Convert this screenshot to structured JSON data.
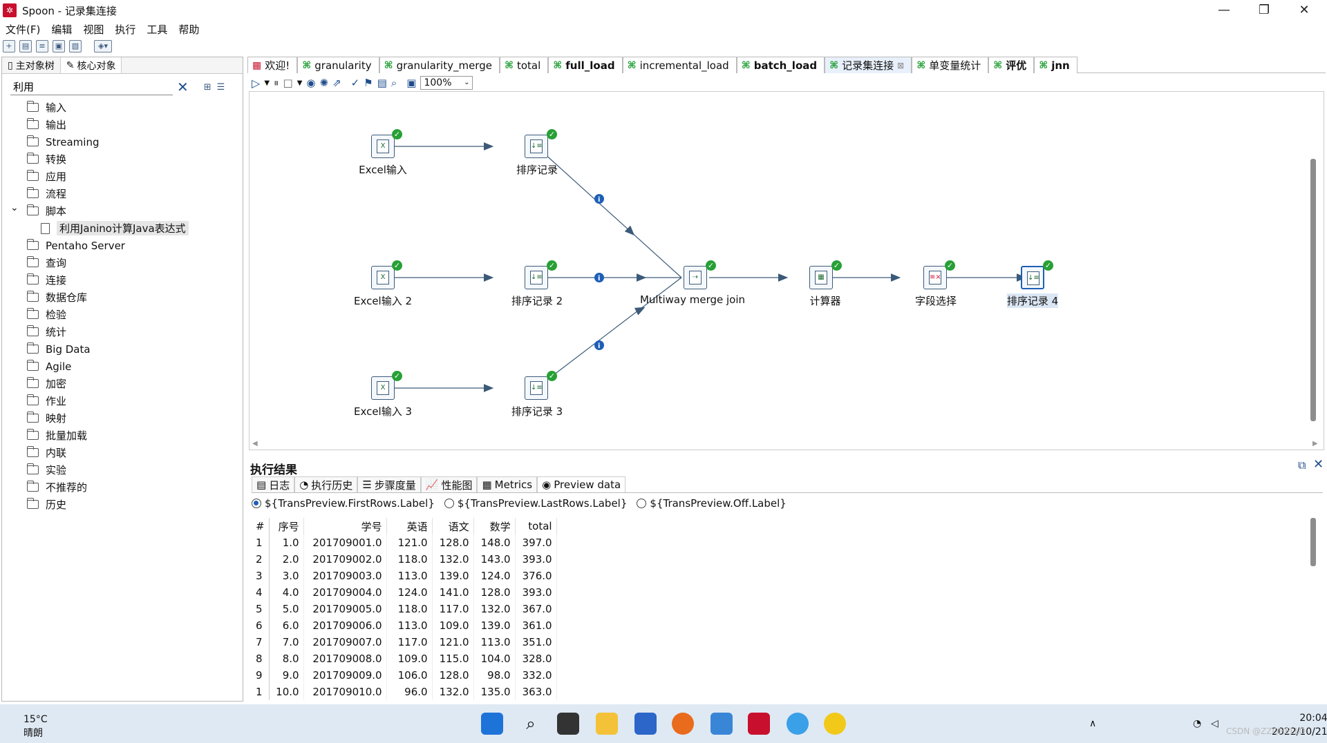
{
  "window": {
    "title": "Spoon - 记录集连接",
    "app_icon": "kettle-icon"
  },
  "menu": [
    "文件(F)",
    "编辑",
    "视图",
    "执行",
    "工具",
    "帮助"
  ],
  "left_panel": {
    "tabs": [
      "主对象树",
      "核心对象"
    ],
    "search_value": "利用",
    "tree": [
      {
        "label": "输入",
        "level": 0
      },
      {
        "label": "输出",
        "level": 0
      },
      {
        "label": "Streaming",
        "level": 0
      },
      {
        "label": "转换",
        "level": 0
      },
      {
        "label": "应用",
        "level": 0
      },
      {
        "label": "流程",
        "level": 0
      },
      {
        "label": "脚本",
        "level": 0,
        "expanded": true
      },
      {
        "label": "利用Janino计算Java表达式",
        "level": 1,
        "leaf": true
      },
      {
        "label": "Pentaho Server",
        "level": 0
      },
      {
        "label": "查询",
        "level": 0
      },
      {
        "label": "连接",
        "level": 0
      },
      {
        "label": "数据仓库",
        "level": 0
      },
      {
        "label": "检验",
        "level": 0
      },
      {
        "label": "统计",
        "level": 0
      },
      {
        "label": "Big Data",
        "level": 0
      },
      {
        "label": "Agile",
        "level": 0
      },
      {
        "label": "加密",
        "level": 0
      },
      {
        "label": "作业",
        "level": 0
      },
      {
        "label": "映射",
        "level": 0
      },
      {
        "label": "批量加载",
        "level": 0
      },
      {
        "label": "内联",
        "level": 0
      },
      {
        "label": "实验",
        "level": 0
      },
      {
        "label": "不推荐的",
        "level": 0
      },
      {
        "label": "历史",
        "level": 0
      }
    ]
  },
  "editor_tabs": [
    {
      "label": "欢迎!",
      "bold": false,
      "active": false
    },
    {
      "label": "granularity",
      "bold": false,
      "active": false
    },
    {
      "label": "granularity_merge",
      "bold": false,
      "active": false
    },
    {
      "label": "total",
      "bold": false,
      "active": false
    },
    {
      "label": "full_load",
      "bold": true,
      "active": false
    },
    {
      "label": "incremental_load",
      "bold": false,
      "active": false
    },
    {
      "label": "batch_load",
      "bold": true,
      "active": false
    },
    {
      "label": "记录集连接",
      "bold": false,
      "active": true
    },
    {
      "label": "单变量统计",
      "bold": false,
      "active": false
    },
    {
      "label": "评优",
      "bold": true,
      "active": false
    },
    {
      "label": "jnn",
      "bold": true,
      "active": false
    }
  ],
  "zoom": "100%",
  "flow": {
    "nodes": [
      {
        "id": "n1",
        "label": "Excel输入"
      },
      {
        "id": "n2",
        "label": "排序记录"
      },
      {
        "id": "n3",
        "label": "Excel输入 2"
      },
      {
        "id": "n4",
        "label": "排序记录 2"
      },
      {
        "id": "n5",
        "label": "Excel输入 3"
      },
      {
        "id": "n6",
        "label": "排序记录 3"
      },
      {
        "id": "n7",
        "label": "Multiway merge join"
      },
      {
        "id": "n8",
        "label": "计算器"
      },
      {
        "id": "n9",
        "label": "字段选择"
      },
      {
        "id": "n10",
        "label": "排序记录 4"
      }
    ]
  },
  "results": {
    "title": "执行结果",
    "tabs": [
      "日志",
      "执行历史",
      "步骤度量",
      "性能图",
      "Metrics",
      "Preview data"
    ],
    "radios": [
      "${TransPreview.FirstRows.Label}",
      "${TransPreview.LastRows.Label}",
      "${TransPreview.Off.Label}"
    ],
    "columns": [
      "#",
      "序号",
      "学号",
      "英语",
      "语文",
      "数学",
      "total"
    ],
    "rows": [
      [
        "1",
        "1.0",
        "201709001.0",
        "121.0",
        "128.0",
        "148.0",
        "397.0"
      ],
      [
        "2",
        "2.0",
        "201709002.0",
        "118.0",
        "132.0",
        "143.0",
        "393.0"
      ],
      [
        "3",
        "3.0",
        "201709003.0",
        "113.0",
        "139.0",
        "124.0",
        "376.0"
      ],
      [
        "4",
        "4.0",
        "201709004.0",
        "124.0",
        "141.0",
        "128.0",
        "393.0"
      ],
      [
        "5",
        "5.0",
        "201709005.0",
        "118.0",
        "117.0",
        "132.0",
        "367.0"
      ],
      [
        "6",
        "6.0",
        "201709006.0",
        "113.0",
        "109.0",
        "139.0",
        "361.0"
      ],
      [
        "7",
        "7.0",
        "201709007.0",
        "117.0",
        "121.0",
        "113.0",
        "351.0"
      ],
      [
        "8",
        "8.0",
        "201709008.0",
        "109.0",
        "115.0",
        "104.0",
        "328.0"
      ],
      [
        "9",
        "9.0",
        "201709009.0",
        "106.0",
        "128.0",
        "98.0",
        "332.0"
      ],
      [
        "1",
        "10.0",
        "201709010.0",
        "96.0",
        "132.0",
        "135.0",
        "363.0"
      ]
    ]
  },
  "taskbar": {
    "weather_temp": "15°C",
    "weather_desc": "晴朗",
    "time": "20:04",
    "date": "2022/10/21",
    "watermark": "CSDN @ZZQHELLO"
  }
}
